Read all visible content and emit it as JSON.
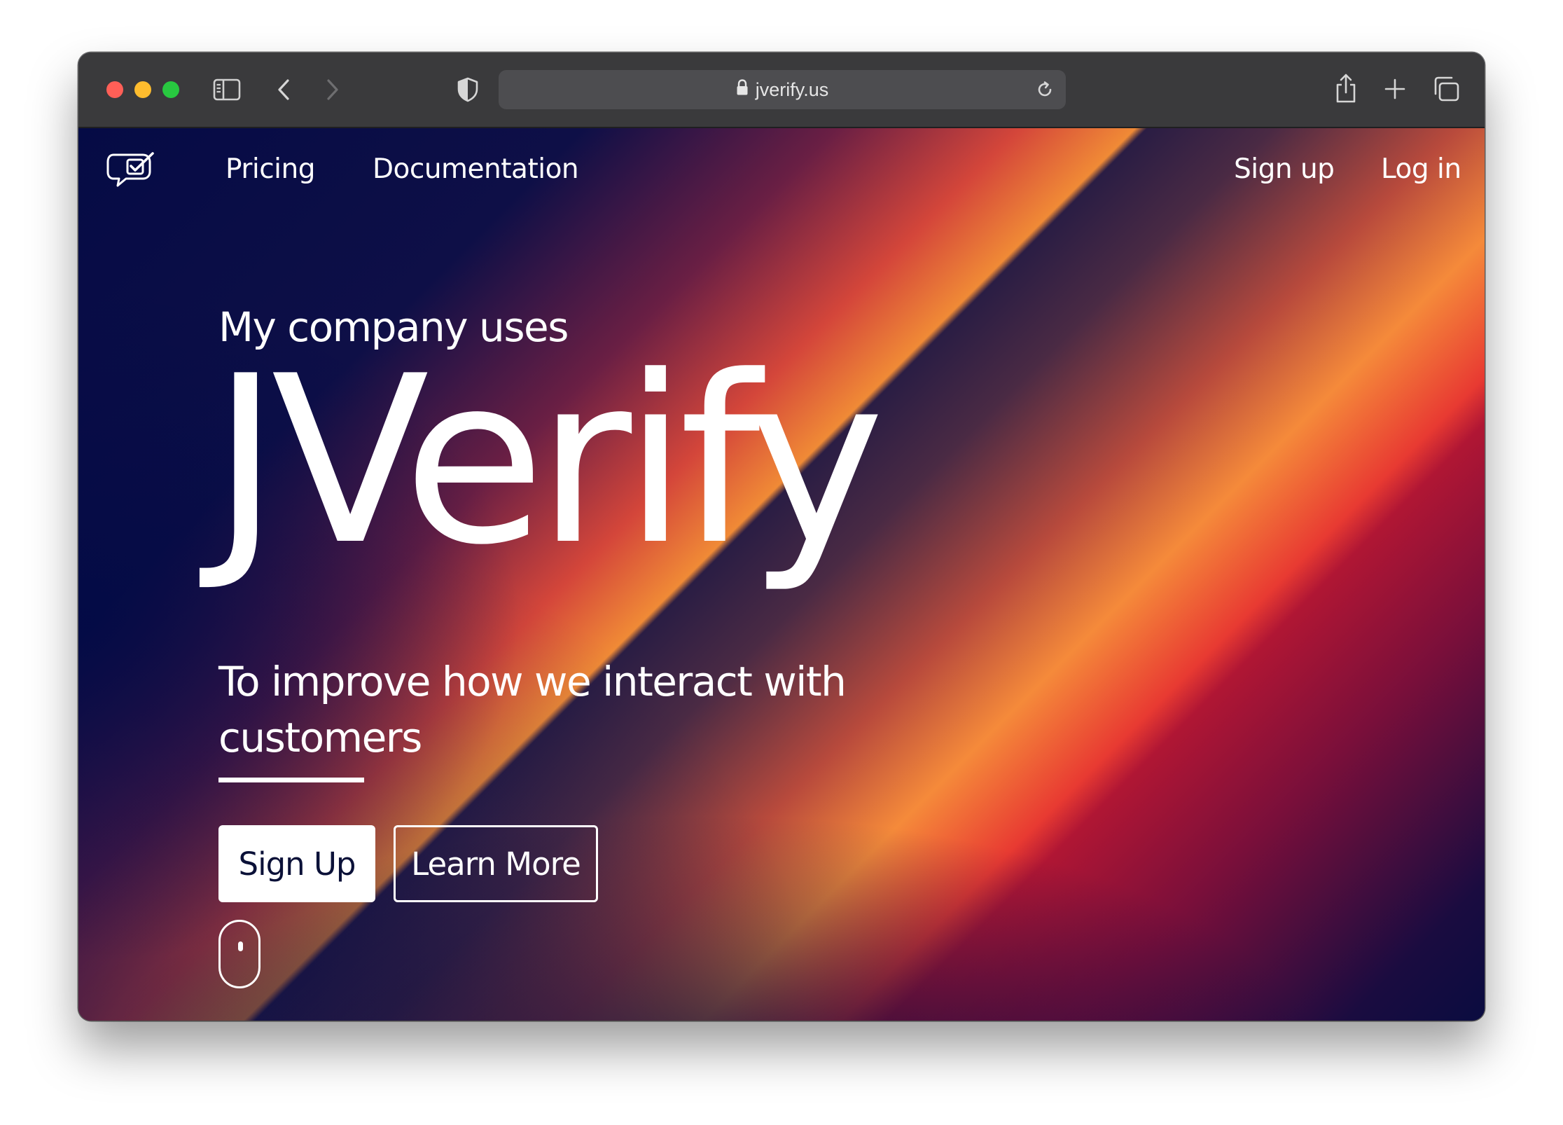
{
  "browser": {
    "url": "jverify.us",
    "icons": {
      "sidebar": "sidebar-icon",
      "back": "chevron-left-icon",
      "forward": "chevron-right-icon",
      "privacy": "shield-icon",
      "lock": "lock-icon",
      "reload": "reload-icon",
      "share": "share-icon",
      "new_tab": "plus-icon",
      "tabs": "tab-overview-icon"
    }
  },
  "nav": {
    "logo": "speech-bubble-check-icon",
    "links": [
      "Pricing",
      "Documentation"
    ],
    "sign_up": "Sign up",
    "log_in": "Log in"
  },
  "hero": {
    "kicker": "My company uses",
    "title": "JVerify",
    "subtitle": "To improve how we interact with customers",
    "primary_button": "Sign Up",
    "secondary_button": "Learn More",
    "scroll_indicator": "mouse-scroll-icon"
  },
  "colors": {
    "toolbar_bg": "#3a3a3c",
    "address_bg": "#4d4d50",
    "hero_navy": "#050b45",
    "hero_orange": "#f08a36",
    "hero_red": "#e83a32",
    "hero_crimson": "#b01634",
    "button_text": "#0b1138"
  }
}
